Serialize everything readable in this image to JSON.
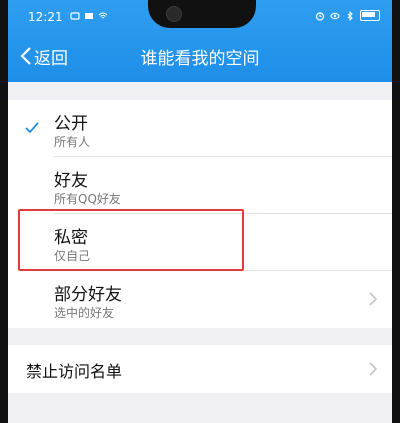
{
  "status_bar": {
    "time": "12:21"
  },
  "nav": {
    "back_label": "返回",
    "title": "谁能看我的空间"
  },
  "options": [
    {
      "title": "公开",
      "subtitle": "所有人",
      "selected": true,
      "has_chevron": false
    },
    {
      "title": "好友",
      "subtitle": "所有QQ好友",
      "selected": false,
      "has_chevron": false
    },
    {
      "title": "私密",
      "subtitle": "仅自己",
      "selected": false,
      "has_chevron": false,
      "highlighted": true
    },
    {
      "title": "部分好友",
      "subtitle": "选中的好友",
      "selected": false,
      "has_chevron": true
    }
  ],
  "blocklist": {
    "label": "禁止访问名单"
  },
  "colors": {
    "accent": "#1e8ee8",
    "highlight_box": "#e33b3b"
  }
}
